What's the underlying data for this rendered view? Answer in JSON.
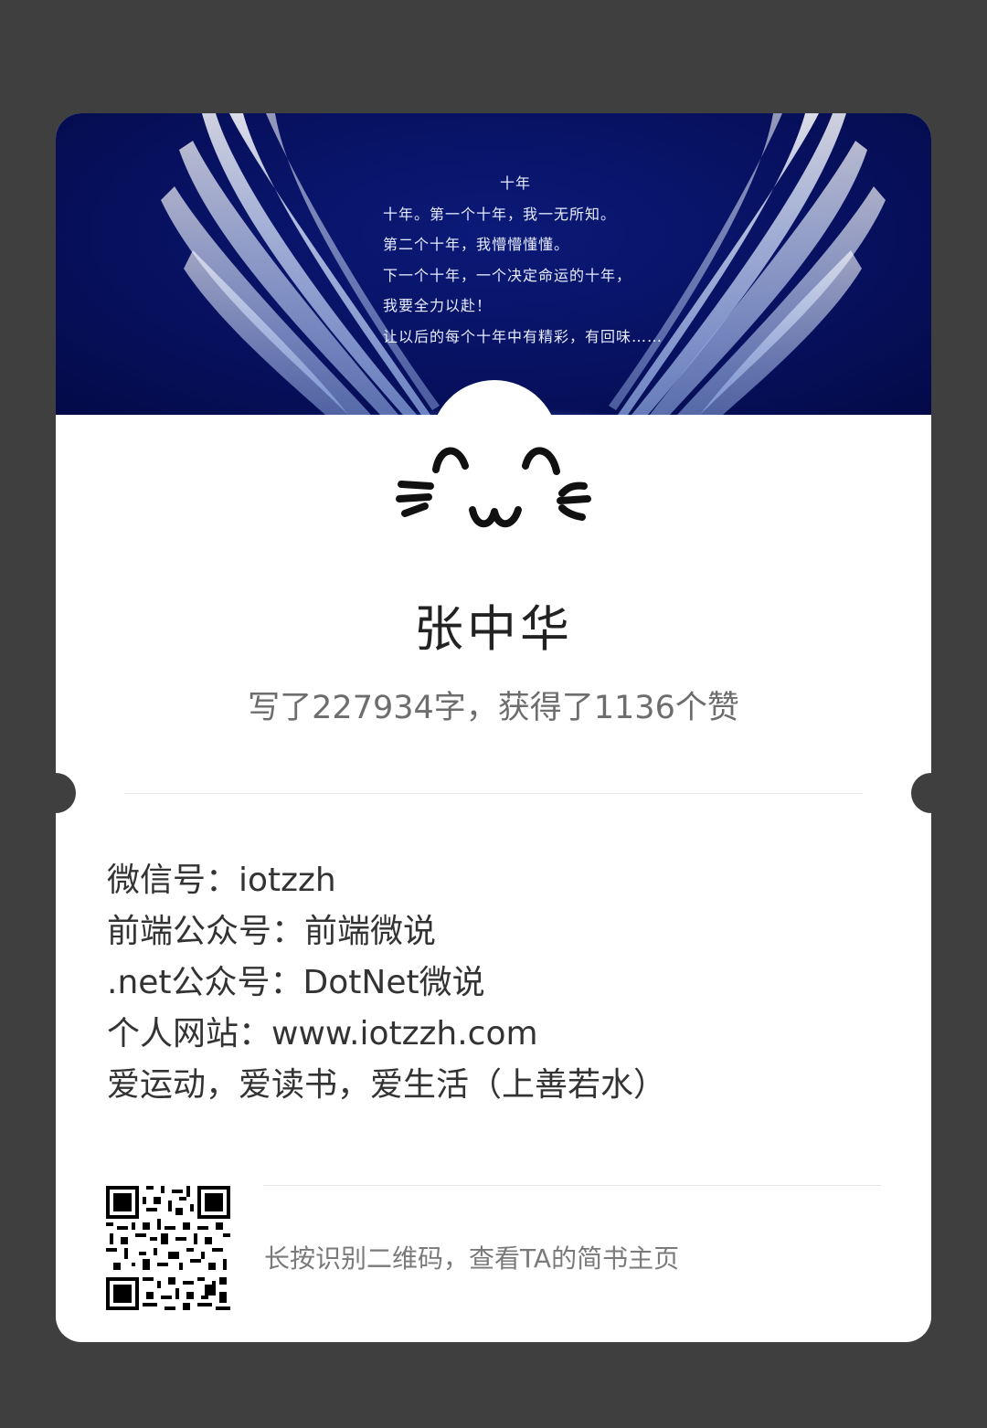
{
  "banner": {
    "poem_title": "十年",
    "poem_lines": [
      "十年。第一个十年，我一无所知。",
      "第二个十年，我懵懵懂懂。",
      "下一个十年，一个决定命运的十年，",
      "我要全力以赴！",
      "让以后的每个十年中有精彩，有回味……"
    ]
  },
  "profile": {
    "avatar_icon": "cat-face-icon",
    "name": "张中华",
    "stats": "写了227934字，获得了1136个赞"
  },
  "bio": {
    "lines": [
      "微信号：iotzzh",
      "前端公众号：前端微说",
      ".net公众号：DotNet微说",
      "个人网站：www.iotzzh.com",
      "爱运动，爱读书，爱生活（上善若水）"
    ]
  },
  "footer": {
    "qr_icon": "qr-code-icon",
    "caption": "长按识别二维码，查看TA的简书主页"
  },
  "colors": {
    "background": "#3f3f3f",
    "card": "#ffffff",
    "banner": "#071160"
  }
}
